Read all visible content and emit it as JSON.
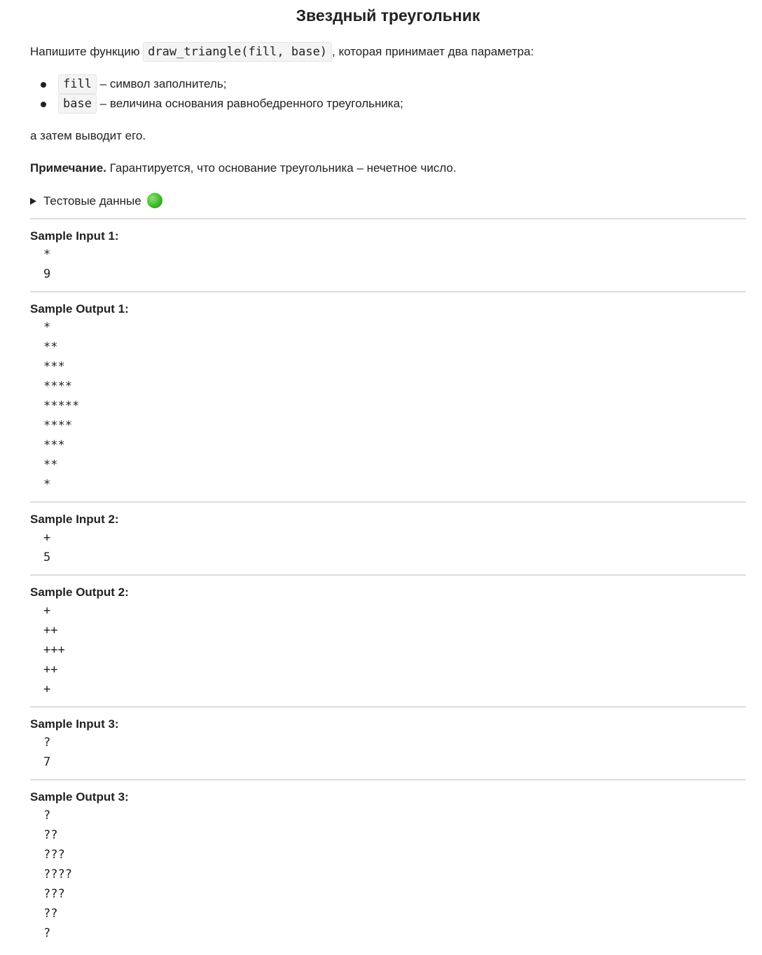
{
  "title": "Звездный треугольник",
  "intro": {
    "before": "Напишите функцию ",
    "code": "draw_triangle(fill, base)",
    "after": ", которая принимает два параметра:"
  },
  "params": [
    {
      "code": "fill",
      "text": " – символ заполнитель;"
    },
    {
      "code": "base",
      "text": " – величина основания равнобедренного треугольника;"
    }
  ],
  "outro": "а затем выводит его.",
  "note": {
    "label": "Примечание.",
    "text": " Гарантируется, что основание треугольника – нечетное число."
  },
  "details_label": "Тестовые данные",
  "details_icon": "green-circle-icon",
  "samples": [
    {
      "heading": "Sample Input 1:",
      "lines": [
        "*",
        "9"
      ]
    },
    {
      "heading": "Sample Output 1:",
      "lines": [
        "*",
        "**",
        "***",
        "****",
        "*****",
        "****",
        "***",
        "**",
        "*"
      ]
    },
    {
      "heading": "Sample Input 2:",
      "lines": [
        "+",
        "5"
      ]
    },
    {
      "heading": "Sample Output 2:",
      "lines": [
        "+",
        "++",
        "+++",
        "++",
        "+"
      ]
    },
    {
      "heading": "Sample Input 3:",
      "lines": [
        "?",
        "7"
      ]
    },
    {
      "heading": "Sample Output 3:",
      "lines": [
        "?",
        "??",
        "???",
        "????",
        "???",
        "??",
        "?"
      ]
    }
  ],
  "colors": {
    "text": "#222222",
    "rule": "#dddddd",
    "code_bg": "#f4f4f4"
  }
}
